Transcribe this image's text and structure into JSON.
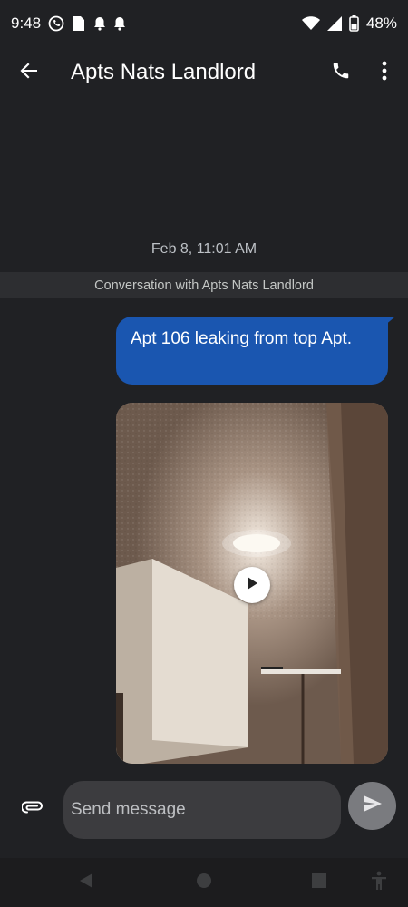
{
  "status_bar": {
    "time": "9:48",
    "battery": "48%",
    "icons_left": [
      "whatsapp-icon",
      "file-icon",
      "bell-icon",
      "bell-icon"
    ],
    "icons_right": [
      "wifi-icon",
      "signal-icon",
      "battery-icon"
    ]
  },
  "app_bar": {
    "title": "Apts Nats Landlord",
    "icons": [
      "back-arrow-icon",
      "phone-icon",
      "more-vertical-icon"
    ]
  },
  "conversation": {
    "timestamp": "Feb 8, 11:01 AM",
    "banner": "Conversation with Apts Nats Landlord",
    "messages": [
      {
        "type": "text",
        "direction": "outgoing",
        "text": "Apt 106 leaking from top Apt."
      },
      {
        "type": "video",
        "direction": "outgoing",
        "icon": "play-icon"
      }
    ]
  },
  "composer": {
    "placeholder": "Send message",
    "value": "",
    "icons": [
      "paperclip-icon",
      "send-icon"
    ]
  },
  "nav_bar": {
    "icons": [
      "back-triangle-icon",
      "home-circle-icon",
      "recents-square-icon",
      "accessibility-icon"
    ]
  },
  "colors": {
    "background": "#202124",
    "outgoing_bubble": "#1a56b0",
    "banner_background": "#2d2e31",
    "input_background": "#3c3c3f",
    "send_button": "#7a7b7f"
  }
}
